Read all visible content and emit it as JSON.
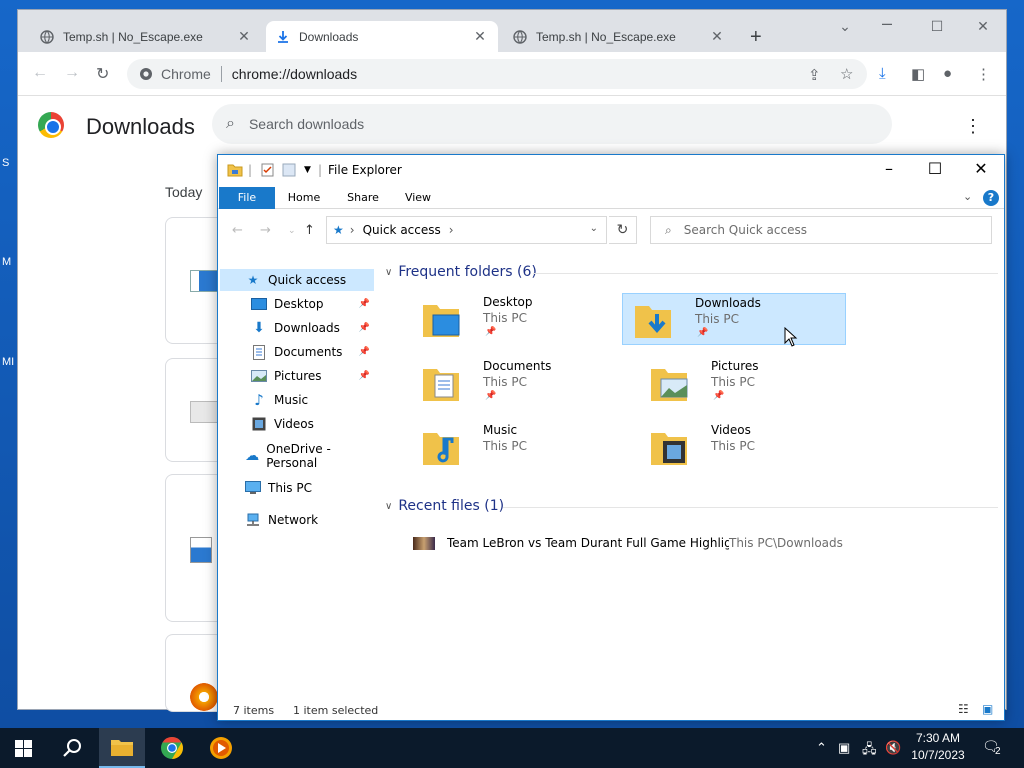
{
  "desktop": {
    "fragments": [
      "S",
      "M",
      "MI"
    ]
  },
  "chrome": {
    "tabs": [
      {
        "title": "Temp.sh | No_Escape.exe",
        "active": false
      },
      {
        "title": "Downloads",
        "active": true
      },
      {
        "title": "Temp.sh | No_Escape.exe",
        "active": false
      }
    ],
    "omnibox": {
      "chip": "Chrome",
      "url": "chrome://downloads"
    },
    "page": {
      "title": "Downloads",
      "search_placeholder": "Search downloads",
      "section": "Today"
    }
  },
  "explorer": {
    "title": "File Explorer",
    "ribbon": {
      "tabs": [
        "File",
        "Home",
        "Share",
        "View"
      ],
      "help": "?"
    },
    "address": {
      "location": "Quick access"
    },
    "search_placeholder": "Search Quick access",
    "nav": [
      {
        "label": "Quick access",
        "pinned": false,
        "selected": true
      },
      {
        "label": "Desktop",
        "pinned": true
      },
      {
        "label": "Downloads",
        "pinned": true
      },
      {
        "label": "Documents",
        "pinned": true
      },
      {
        "label": "Pictures",
        "pinned": true
      },
      {
        "label": "Music",
        "pinned": false
      },
      {
        "label": "Videos",
        "pinned": false
      },
      {
        "label": "OneDrive - Personal",
        "pinned": false
      },
      {
        "label": "This PC",
        "pinned": false
      },
      {
        "label": "Network",
        "pinned": false
      }
    ],
    "frequent": {
      "header": "Frequent folders (6)",
      "folders": [
        {
          "name": "Desktop",
          "location": "This PC",
          "pinned": true
        },
        {
          "name": "Downloads",
          "location": "This PC",
          "pinned": true,
          "selected": true
        },
        {
          "name": "Documents",
          "location": "This PC",
          "pinned": true
        },
        {
          "name": "Pictures",
          "location": "This PC",
          "pinned": true
        },
        {
          "name": "Music",
          "location": "This PC",
          "pinned": false
        },
        {
          "name": "Videos",
          "location": "This PC",
          "pinned": false
        }
      ]
    },
    "recent": {
      "header": "Recent files (1)",
      "files": [
        {
          "name": "Team LeBron vs Team Durant Full Game Highligh...",
          "path": "This PC\\Downloads"
        }
      ]
    },
    "status": {
      "items": "7 items",
      "selected": "1 item selected"
    }
  },
  "taskbar": {
    "time": "7:30 AM",
    "date": "10/7/2023",
    "notifications": "2"
  },
  "colors": {
    "accent": "#1979ca",
    "selection": "#cce8ff",
    "taskbar": "#0b1a2b"
  }
}
